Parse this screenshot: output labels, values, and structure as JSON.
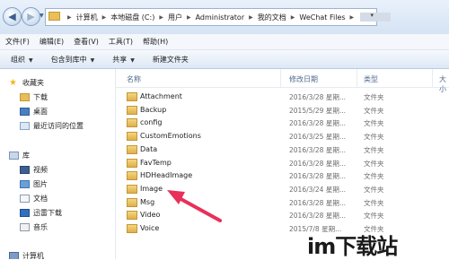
{
  "address": {
    "crumbs": [
      "计算机",
      "本地磁盘 (C:)",
      "用户",
      "Administrator",
      "我的文档",
      "WeChat Files"
    ]
  },
  "menu": [
    "文件(F)",
    "编辑(E)",
    "查看(V)",
    "工具(T)",
    "帮助(H)"
  ],
  "toolbar": {
    "organize": "组织",
    "include": "包含到库中",
    "share": "共享",
    "new_folder": "新建文件夹"
  },
  "nav": {
    "favorites": "收藏夹",
    "downloads": "下载",
    "desktop": "桌面",
    "recent": "最近访问的位置",
    "libraries": "库",
    "videos": "视频",
    "pictures": "图片",
    "documents": "文档",
    "xunlei": "迅雷下载",
    "music": "音乐",
    "computer": "计算机"
  },
  "columns": {
    "name": "名称",
    "date": "修改日期",
    "type": "类型",
    "size": "大小"
  },
  "files": [
    {
      "name": "Attachment",
      "date": "2016/3/28 星期...",
      "type": "文件夹"
    },
    {
      "name": "Backup",
      "date": "2015/5/29 星期...",
      "type": "文件夹"
    },
    {
      "name": "config",
      "date": "2016/3/28 星期...",
      "type": "文件夹"
    },
    {
      "name": "CustomEmotions",
      "date": "2016/3/25 星期...",
      "type": "文件夹"
    },
    {
      "name": "Data",
      "date": "2016/3/28 星期...",
      "type": "文件夹"
    },
    {
      "name": "FavTemp",
      "date": "2016/3/28 星期...",
      "type": "文件夹"
    },
    {
      "name": "HDHeadImage",
      "date": "2016/3/28 星期...",
      "type": "文件夹"
    },
    {
      "name": "Image",
      "date": "2016/3/24 星期...",
      "type": "文件夹"
    },
    {
      "name": "Msg",
      "date": "2016/3/28 星期...",
      "type": "文件夹"
    },
    {
      "name": "Video",
      "date": "2016/3/28 星期...",
      "type": "文件夹"
    },
    {
      "name": "Voice",
      "date": "2015/7/8 星期...",
      "type": "文件夹"
    }
  ],
  "watermark": "im下载站",
  "colors": {
    "arrow": "#e8305a",
    "folder": "#e0b04a"
  }
}
